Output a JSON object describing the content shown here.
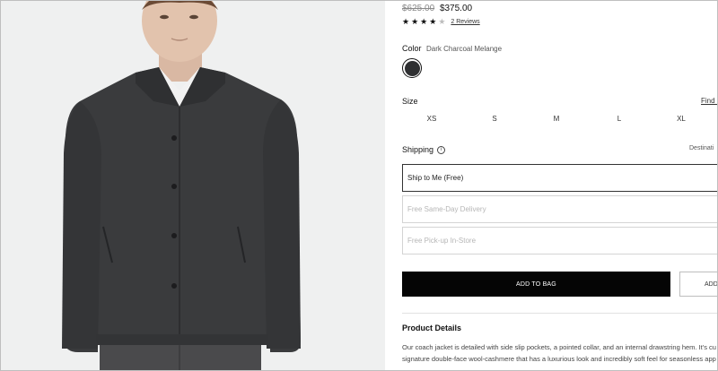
{
  "product": {
    "price_original": "$625.00",
    "price_sale": "$375.00",
    "rating": 4,
    "rating_max": 5,
    "reviews_link": "2 Reviews"
  },
  "color": {
    "label": "Color",
    "value": "Dark Charcoal Melange",
    "swatch_hex": "#2f3032"
  },
  "size": {
    "label": "Size",
    "guide_link": "Find m",
    "options": [
      "XS",
      "S",
      "M",
      "L",
      "XL"
    ]
  },
  "shipping": {
    "label": "Shipping",
    "destination_label": "Destinati",
    "options": [
      "Ship to Me (Free)",
      "Free Same-Day Delivery",
      "Free Pick-up In-Store"
    ]
  },
  "actions": {
    "add_to_bag": "ADD TO BAG",
    "secondary_button": "ADD T"
  },
  "product_details": {
    "title": "Product Details",
    "line1": "Our coach jacket is detailed with side slip pockets, a pointed collar, and an internal drawstring hem. It's cu",
    "line2": "signature double-face wool-cashmere that has a luxurious look and incredibly soft feel for seasonless app"
  },
  "colors": {
    "image_background": "#eff0f0",
    "jacket": "#3a3b3d",
    "button_black": "#050505"
  }
}
